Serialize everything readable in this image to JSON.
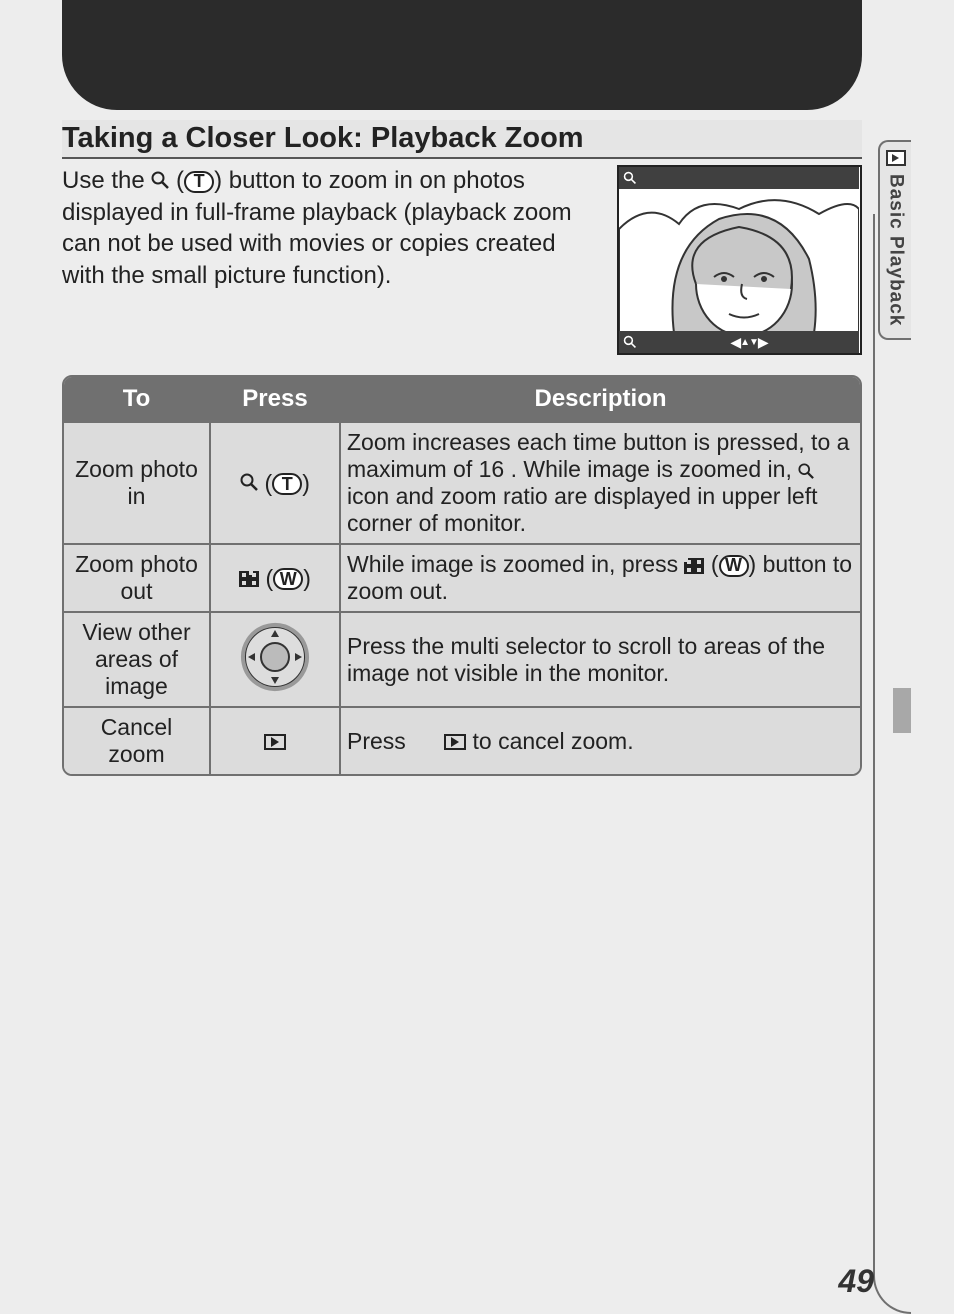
{
  "section": {
    "title": "Taking a Closer Look: Playback Zoom",
    "intro_prefix": "Use the ",
    "intro_mid": " (",
    "intro_after_t": ") button to zoom in on photos displayed in full-frame playback (playback zoom can not be used with movies or copies created with the small picture function)."
  },
  "t_label": "T",
  "w_label": "W",
  "table": {
    "headers": {
      "to": "To",
      "press": "Press",
      "desc": "Description"
    },
    "rows": [
      {
        "to": "Zoom photo in",
        "desc_a": "Zoom increases each time button is pressed, to a maximum of 16 . While image is zoomed in, ",
        "desc_b": " icon and zoom ratio are displayed in upper left corner of monitor."
      },
      {
        "to": "Zoom photo out",
        "desc_a": "While image is zoomed in, press ",
        "desc_b": " (",
        "desc_c": ") button to zoom out."
      },
      {
        "to": "View other areas of image",
        "desc": "Press the multi selector to scroll to areas of the image not visible in the monitor."
      },
      {
        "to": "Cancel zoom",
        "desc_a": "Press ",
        "desc_b": " to cancel zoom."
      }
    ]
  },
  "sidebar": {
    "label": "Basic Playback"
  },
  "page_number": "49"
}
